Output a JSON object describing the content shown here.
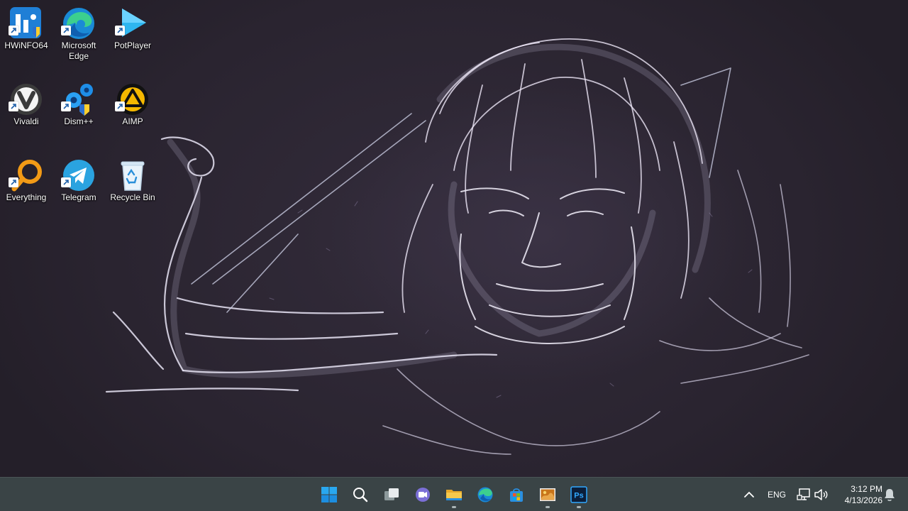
{
  "desktop": {
    "icons": [
      {
        "label": "HWiNFO64",
        "icon": "hwinfo-icon",
        "shortcut": true
      },
      {
        "label": "Microsoft Edge",
        "icon": "edge-icon",
        "shortcut": true
      },
      {
        "label": "PotPlayer",
        "icon": "potplayer-icon",
        "shortcut": true
      },
      {
        "label": "Vivaldi",
        "icon": "vivaldi-icon",
        "shortcut": true
      },
      {
        "label": "Dism++",
        "icon": "dism-icon",
        "shortcut": true
      },
      {
        "label": "AIMP",
        "icon": "aimp-icon",
        "shortcut": true
      },
      {
        "label": "Everything",
        "icon": "everything-icon",
        "shortcut": true
      },
      {
        "label": "Telegram",
        "icon": "telegram-icon",
        "shortcut": true
      },
      {
        "label": "Recycle Bin",
        "icon": "recycle-bin-icon",
        "shortcut": false
      }
    ]
  },
  "taskbar": {
    "pinned": [
      {
        "name": "start",
        "icon": "windows-start-icon",
        "running": false
      },
      {
        "name": "search",
        "icon": "search-icon",
        "running": false
      },
      {
        "name": "task-view",
        "icon": "task-view-icon",
        "running": false
      },
      {
        "name": "chat",
        "icon": "teams-chat-icon",
        "running": false
      },
      {
        "name": "file-explorer",
        "icon": "folder-icon",
        "running": true
      },
      {
        "name": "edge",
        "icon": "edge-icon",
        "running": false
      },
      {
        "name": "store",
        "icon": "store-icon",
        "running": false
      },
      {
        "name": "photo-viewer",
        "icon": "image-viewer-icon",
        "running": true
      },
      {
        "name": "photoshop",
        "icon": "photoshop-icon",
        "running": true
      }
    ],
    "tray": {
      "language": "ENG",
      "time": "3:12 PM",
      "date": "4/13/2026"
    }
  },
  "colors": {
    "taskbar_bg": "#3a4446",
    "wallpaper_bg": "#2b2532",
    "accent": "#0078d4"
  }
}
